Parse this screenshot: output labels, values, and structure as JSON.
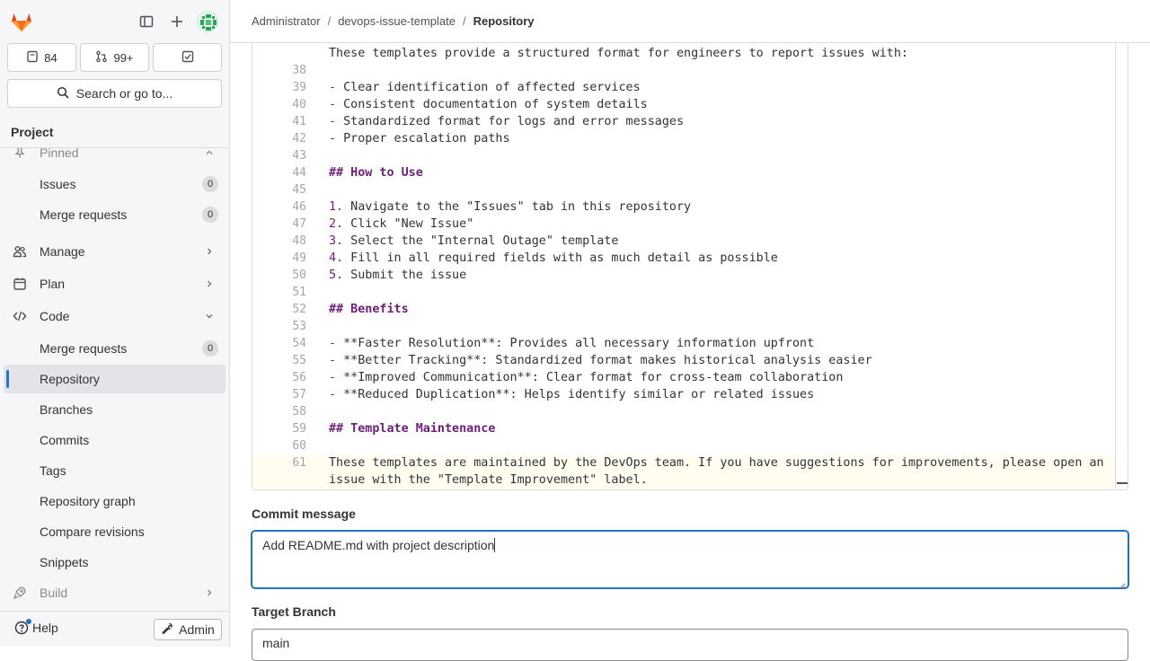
{
  "sidebar": {
    "counters": [
      {
        "icon": "issues-icon",
        "value": "84"
      },
      {
        "icon": "merge-request-icon",
        "value": "99+"
      },
      {
        "icon": "todo-icon",
        "value": ""
      }
    ],
    "search_label": "Search or go to...",
    "section_title": "Project",
    "items": [
      {
        "label": "Pinned",
        "icon": "pin-icon"
      },
      {
        "label": "Issues",
        "badge": "0"
      },
      {
        "label": "Merge requests",
        "badge": "0"
      },
      {
        "label": "Manage",
        "icon": "users-icon"
      },
      {
        "label": "Plan",
        "icon": "calendar-icon"
      },
      {
        "label": "Code",
        "icon": "code-icon"
      },
      {
        "label": "Merge requests",
        "badge": "0"
      },
      {
        "label": "Repository"
      },
      {
        "label": "Branches"
      },
      {
        "label": "Commits"
      },
      {
        "label": "Tags"
      },
      {
        "label": "Repository graph"
      },
      {
        "label": "Compare revisions"
      },
      {
        "label": "Snippets"
      },
      {
        "label": "Build",
        "icon": "rocket-icon"
      }
    ],
    "help_label": "Help",
    "admin_label": "Admin"
  },
  "breadcrumb": [
    "Administrator",
    "devops-issue-template",
    "Repository"
  ],
  "editor": {
    "lines": [
      {
        "n": "",
        "text": "These templates provide a structured format for engineers to report issues with:"
      },
      {
        "n": "38",
        "text": ""
      },
      {
        "n": "39",
        "mark": "-",
        "text": " Clear identification of affected services"
      },
      {
        "n": "40",
        "mark": "-",
        "text": " Consistent documentation of system details"
      },
      {
        "n": "41",
        "mark": "-",
        "text": " Standardized format for logs and error messages"
      },
      {
        "n": "42",
        "mark": "-",
        "text": " Proper escalation paths"
      },
      {
        "n": "43",
        "text": ""
      },
      {
        "n": "44",
        "heading": "## How to Use"
      },
      {
        "n": "45",
        "text": ""
      },
      {
        "n": "46",
        "mark": "1.",
        "text": " Navigate to the \"Issues\" tab in this repository"
      },
      {
        "n": "47",
        "mark": "2.",
        "text": " Click \"New Issue\""
      },
      {
        "n": "48",
        "mark": "3.",
        "text": " Select the \"Internal Outage\" template"
      },
      {
        "n": "49",
        "mark": "4.",
        "text": " Fill in all required fields with as much detail as possible"
      },
      {
        "n": "50",
        "mark": "5.",
        "text": " Submit the issue"
      },
      {
        "n": "51",
        "text": ""
      },
      {
        "n": "52",
        "heading": "## Benefits"
      },
      {
        "n": "53",
        "text": ""
      },
      {
        "n": "54",
        "mark": "-",
        "text": " **Faster Resolution**: Provides all necessary information upfront"
      },
      {
        "n": "55",
        "mark": "-",
        "text": " **Better Tracking**: Standardized format makes historical analysis easier"
      },
      {
        "n": "56",
        "mark": "-",
        "text": " **Improved Communication**: Clear format for cross-team collaboration"
      },
      {
        "n": "57",
        "mark": "-",
        "text": " **Reduced Duplication**: Helps identify similar or related issues"
      },
      {
        "n": "58",
        "text": ""
      },
      {
        "n": "59",
        "heading": "## Template Maintenance"
      },
      {
        "n": "60",
        "text": ""
      },
      {
        "n": "61",
        "text": "These templates are maintained by the DevOps team. If you have suggestions for improvements, please open an"
      },
      {
        "n": "",
        "text": "issue with the \"Template Improvement\" label."
      }
    ]
  },
  "commit": {
    "label": "Commit message",
    "value": "Add README.md with project description"
  },
  "target": {
    "label": "Target Branch",
    "value": "main"
  },
  "colors": {
    "accent": "#1f75cb",
    "markdown": "#6f1e7a"
  }
}
